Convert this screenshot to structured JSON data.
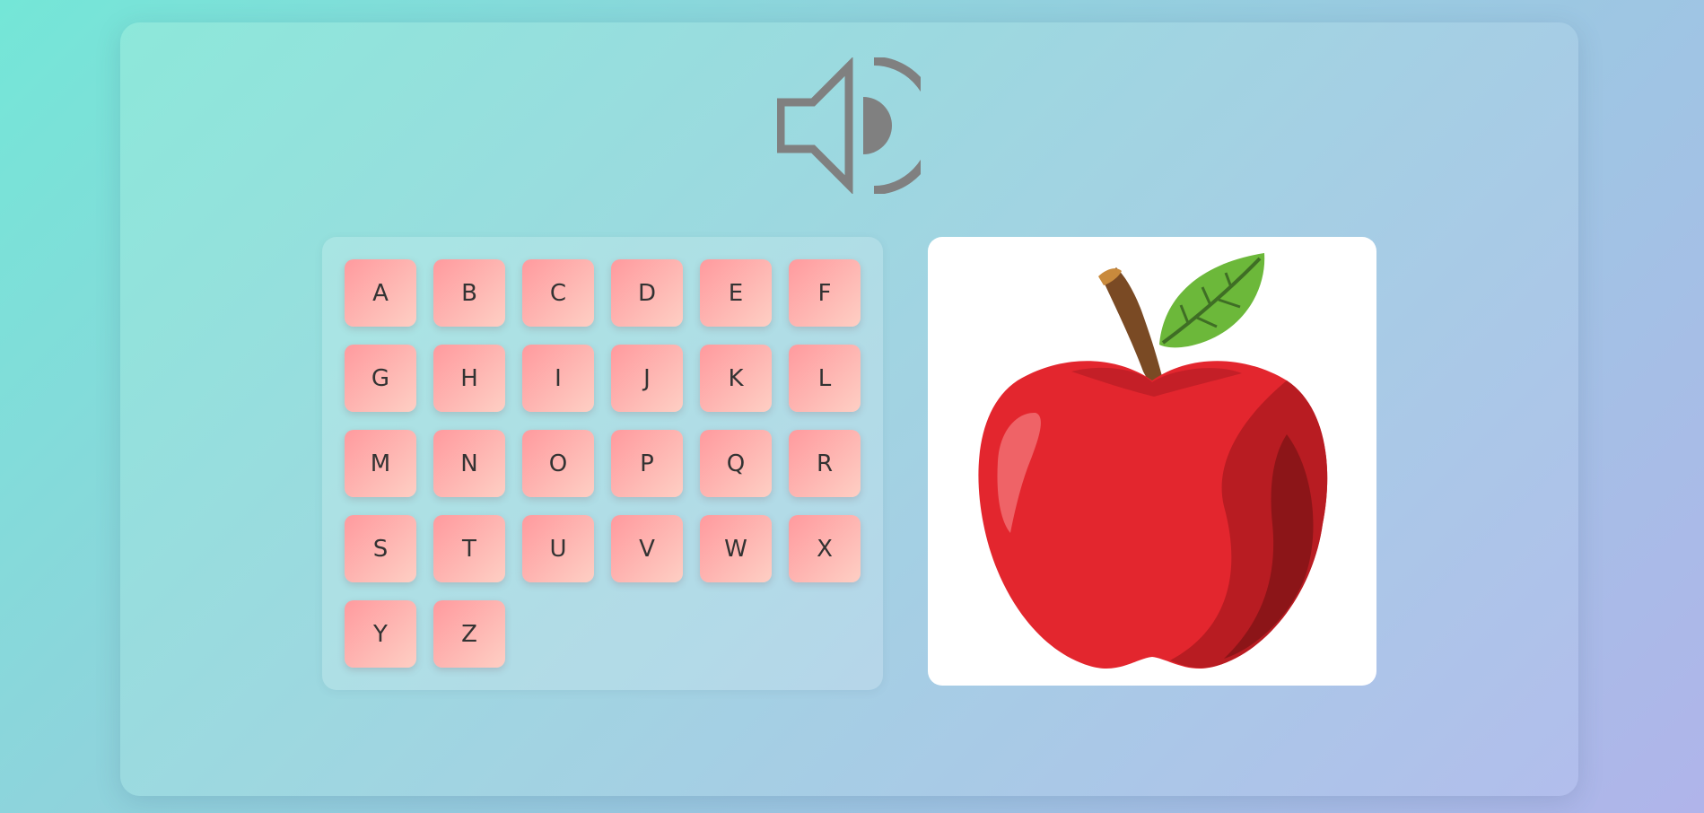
{
  "speaker": {
    "icon": "speaker-icon",
    "color": "#808080"
  },
  "letters": [
    "A",
    "B",
    "C",
    "D",
    "E",
    "F",
    "G",
    "H",
    "I",
    "J",
    "K",
    "L",
    "M",
    "N",
    "O",
    "P",
    "Q",
    "R",
    "S",
    "T",
    "U",
    "V",
    "W",
    "X",
    "Y",
    "Z"
  ],
  "picture": {
    "icon": "apple-icon"
  },
  "colors": {
    "button_gradient_start": "#ff9a9e",
    "button_gradient_end": "#fecfc4",
    "apple_red": "#e3262e",
    "leaf_green": "#6cb83a"
  }
}
